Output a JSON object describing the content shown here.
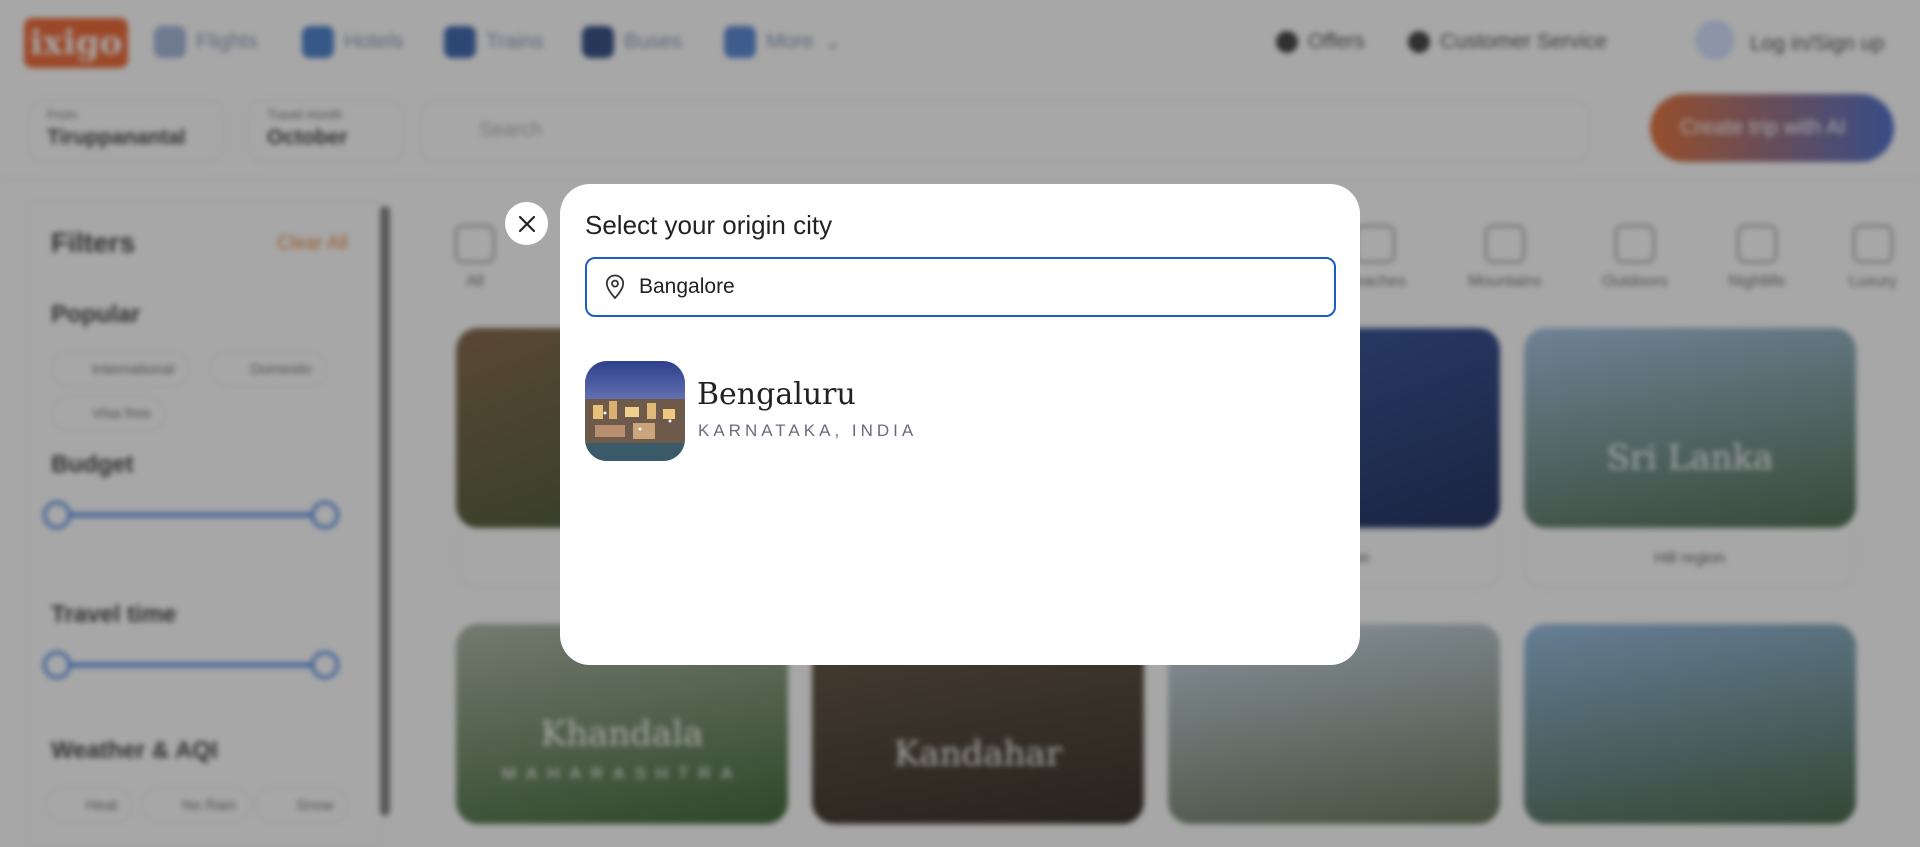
{
  "header": {
    "logo_text": "ixigo",
    "nav": [
      "Flights",
      "Hotels",
      "Trains",
      "Buses",
      "More"
    ],
    "offers": "Offers",
    "customer_service": "Customer Service",
    "login": "Log in/Sign up"
  },
  "toolbar": {
    "from_label": "From",
    "from_value": "Tiruppanantal",
    "month_label": "Travel month",
    "month_value": "October",
    "search_placeholder": "Search",
    "create_trip": "Create trip with AI"
  },
  "filters": {
    "title": "Filters",
    "clear_all": "Clear All",
    "popular_heading": "Popular",
    "popular_chips": [
      "International",
      "Domestic",
      "Visa free"
    ],
    "budget_heading": "Budget",
    "travel_time_heading": "Travel time",
    "weather_heading": "Weather & AQI",
    "weather_chips": [
      "Heat",
      "No Rain",
      "Snow"
    ]
  },
  "categories": [
    "All",
    "Beaches",
    "Mountains",
    "Outdoors",
    "Nightlife",
    "Luxury"
  ],
  "cards": [
    {
      "name": "",
      "sub": "",
      "foot": ""
    },
    {
      "name": "",
      "sub": "",
      "foot": ""
    },
    {
      "name": "",
      "sub": "",
      "foot": "Hill region"
    },
    {
      "name": "Sri Lanka",
      "sub": "",
      "foot": "Hill region"
    },
    {
      "name": "Khandala",
      "sub": "MAHARASHTRA",
      "foot": ""
    },
    {
      "name": "Kandahar",
      "sub": "",
      "foot": ""
    },
    {
      "name": "",
      "sub": "",
      "foot": ""
    },
    {
      "name": "",
      "sub": "",
      "foot": ""
    }
  ],
  "modal": {
    "title": "Select your origin city",
    "input_value": "Bangalore",
    "results": [
      {
        "name": "Bengaluru",
        "region": "KARNATAKA, INDIA"
      }
    ]
  },
  "colors": {
    "accent_blue": "#1a5ec2",
    "brand_orange": "#ec5b24",
    "overlay": "rgba(45,45,45,0.42)"
  }
}
